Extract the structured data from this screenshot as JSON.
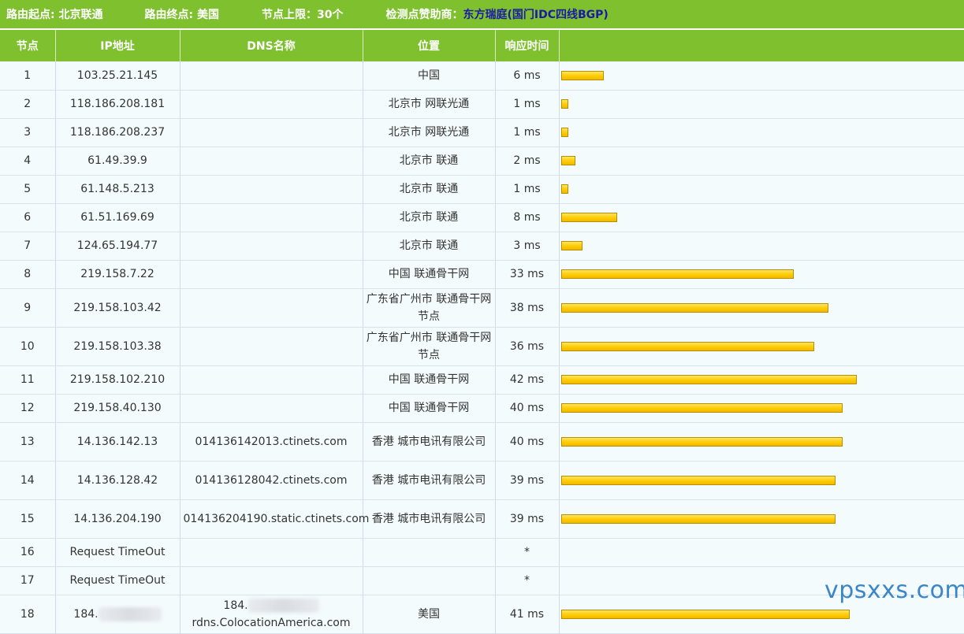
{
  "header": {
    "origin": "路由起点: 北京联通",
    "destination": "路由终点: 美国",
    "limit": "节点上限：30个",
    "sponsor_label": "检测点赞助商：",
    "sponsor_name": "东方瑞庭",
    "sponsor_open": "(",
    "sponsor_detail": "国门IDC四线BGP",
    "sponsor_close": ")"
  },
  "columns": [
    "节点",
    "IP地址",
    "DNS名称",
    "位置",
    "响应时间",
    ""
  ],
  "bar_scale_max_ms": 42,
  "rows": [
    {
      "hop": "1",
      "ip": "103.25.21.145",
      "dns": "",
      "location": "中国",
      "time": "6 ms",
      "ms": 6
    },
    {
      "hop": "2",
      "ip": "118.186.208.181",
      "dns": "",
      "location": "北京市 网联光通",
      "time": "1 ms",
      "ms": 1
    },
    {
      "hop": "3",
      "ip": "118.186.208.237",
      "dns": "",
      "location": "北京市 网联光通",
      "time": "1 ms",
      "ms": 1
    },
    {
      "hop": "4",
      "ip": "61.49.39.9",
      "dns": "",
      "location": "北京市 联通",
      "time": "2 ms",
      "ms": 2
    },
    {
      "hop": "5",
      "ip": "61.148.5.213",
      "dns": "",
      "location": "北京市 联通",
      "time": "1 ms",
      "ms": 1
    },
    {
      "hop": "6",
      "ip": "61.51.169.69",
      "dns": "",
      "location": "北京市 联通",
      "time": "8 ms",
      "ms": 8
    },
    {
      "hop": "7",
      "ip": "124.65.194.77",
      "dns": "",
      "location": "北京市 联通",
      "time": "3 ms",
      "ms": 3
    },
    {
      "hop": "8",
      "ip": "219.158.7.22",
      "dns": "",
      "location": "中国 联通骨干网",
      "time": "33 ms",
      "ms": 33
    },
    {
      "hop": "9",
      "ip": "219.158.103.42",
      "dns": "",
      "location": "广东省广州市 联通骨干网节点",
      "time": "38 ms",
      "ms": 38
    },
    {
      "hop": "10",
      "ip": "219.158.103.38",
      "dns": "",
      "location": "广东省广州市 联通骨干网节点",
      "time": "36 ms",
      "ms": 36
    },
    {
      "hop": "11",
      "ip": "219.158.102.210",
      "dns": "",
      "location": "中国 联通骨干网",
      "time": "42 ms",
      "ms": 42
    },
    {
      "hop": "12",
      "ip": "219.158.40.130",
      "dns": "",
      "location": "中国 联通骨干网",
      "time": "40 ms",
      "ms": 40
    },
    {
      "hop": "13",
      "ip": "14.136.142.13",
      "dns": "014136142013.ctinets.com",
      "location": "香港 城市电讯有限公司",
      "time": "40 ms",
      "ms": 40
    },
    {
      "hop": "14",
      "ip": "14.136.128.42",
      "dns": "014136128042.ctinets.com",
      "location": "香港 城市电讯有限公司",
      "time": "39 ms",
      "ms": 39
    },
    {
      "hop": "15",
      "ip": "14.136.204.190",
      "dns": "014136204190.static.ctinets.com",
      "location": "香港 城市电讯有限公司",
      "time": "39 ms",
      "ms": 39
    },
    {
      "hop": "16",
      "ip": "Request TimeOut",
      "dns": "",
      "location": "",
      "time": "*",
      "ms": null
    },
    {
      "hop": "17",
      "ip": "Request TimeOut",
      "dns": "",
      "location": "",
      "time": "*",
      "ms": null
    },
    {
      "hop": "18",
      "ip": "184.",
      "dns_prefix": "184.",
      "dns_suffix": "rdns.ColocationAmerica.com",
      "location": "美国",
      "time": "41 ms",
      "ms": 41,
      "redacted": true
    }
  ],
  "watermark": "vpsxxs.com"
}
